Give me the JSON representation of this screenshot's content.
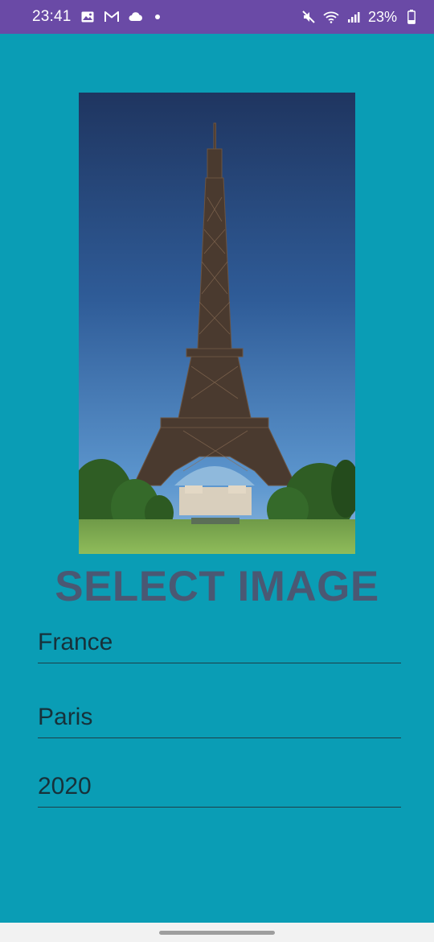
{
  "status": {
    "time": "23:41",
    "battery": "23%",
    "icons_left": [
      "image-icon",
      "gmail-icon",
      "cloud-icon",
      "notification-dot-icon"
    ],
    "icons_right": [
      "mute-icon",
      "wifi-icon",
      "signal-icon",
      "battery-icon"
    ]
  },
  "photo": {
    "subject": "eiffel-tower-photo"
  },
  "main": {
    "select_label": "SELECT IMAGE"
  },
  "fields": {
    "country": "France",
    "city": "Paris",
    "year": "2020"
  },
  "colors": {
    "background": "#0a9db5",
    "status_bar": "#6a4aa6",
    "select_label": "#4a5873",
    "field_text": "#17313a",
    "underline": "#1e3f48",
    "nav_bar": "#f2f2f2"
  }
}
